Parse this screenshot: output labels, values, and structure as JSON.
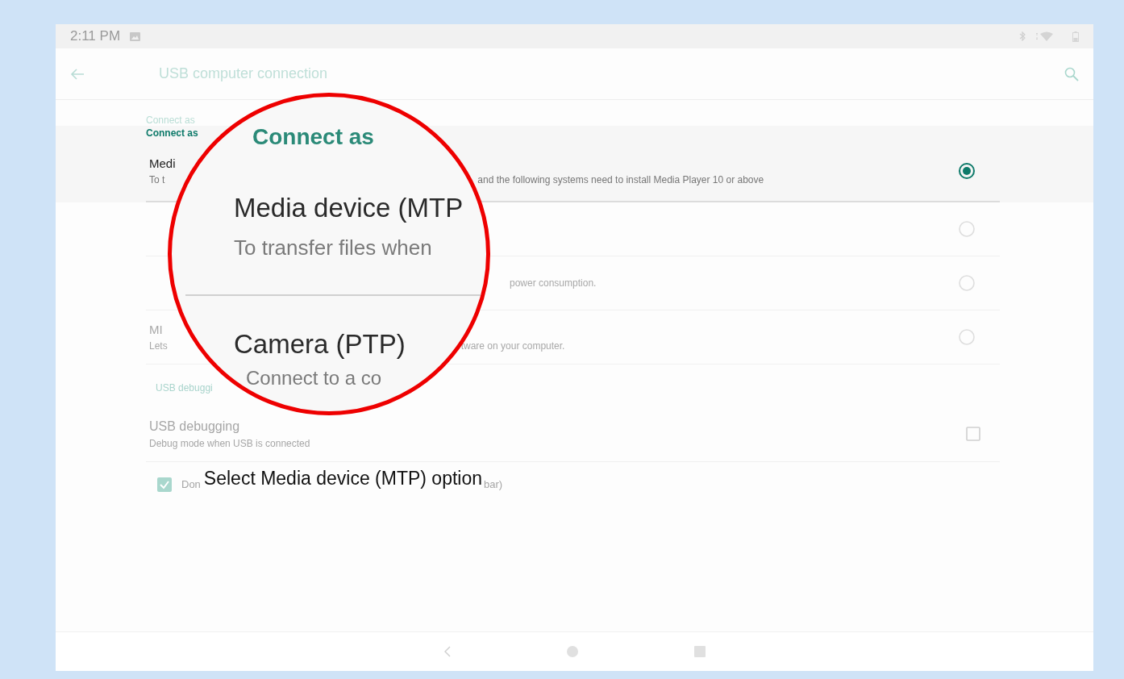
{
  "status_bar": {
    "time": "2:11 PM"
  },
  "toolbar": {
    "title": "USB computer connection"
  },
  "category_labels": [
    {
      "text": "Connect as",
      "kind": "ghost"
    },
    {
      "text": "Connect as",
      "kind": "active"
    }
  ],
  "connect_options": [
    {
      "title": "Medi",
      "summary_start": "To t",
      "summary_end": "and the following systems need to install Media Player 10 or above",
      "selected": true
    },
    {
      "selected": false
    },
    {
      "summary_end": "power consumption.",
      "selected": false
    },
    {
      "title": "MI",
      "summary_start": "Lets",
      "summary_end": "tware on your computer.",
      "selected": false
    }
  ],
  "debugging": {
    "category": "USB debuggi",
    "title": "USB debugging",
    "summary": "Debug mode when USB is connected",
    "checked": false
  },
  "dont_show": {
    "label_start": "Don",
    "label_end": "bar)",
    "checked": true
  },
  "magnifier": {
    "heading": "Connect as",
    "items": [
      {
        "title": "Media device (MTP",
        "summary": "To transfer files when"
      },
      {
        "title": "Camera (PTP)",
        "summary": "Connect to a co"
      }
    ]
  },
  "caption": "Select Media device (MTP) option"
}
